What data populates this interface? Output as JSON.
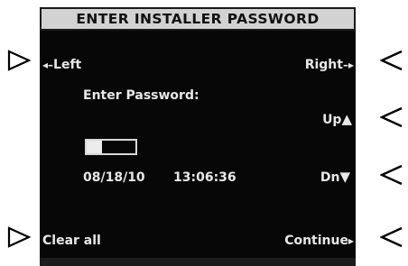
{
  "screen": {
    "title": "ENTER INSTALLER PASSWORD",
    "prompt": "Enter Password:",
    "password_strength_fraction": 0.32,
    "date": "08/18/10",
    "time": "13:06:36"
  },
  "softkeys": {
    "left": {
      "arrow": "◂–",
      "label": "Left",
      "icon": "left-arrow-icon"
    },
    "right": {
      "label": "Right",
      "arrow": "–▸",
      "icon": "right-arrow-icon"
    },
    "up": {
      "label": "Up",
      "arrow": "▲",
      "icon": "up-triangle-icon"
    },
    "down": {
      "label": "Dn",
      "arrow": "▼",
      "icon": "down-triangle-icon"
    },
    "clear": {
      "label": "Clear all"
    },
    "continue": {
      "label": "Continue",
      "arrow": "▸",
      "icon": "continue-arrow-icon"
    }
  },
  "colors": {
    "screen_bg": "#070707",
    "title_bg": "#d2d2d2",
    "text": "#e8e8e8"
  }
}
